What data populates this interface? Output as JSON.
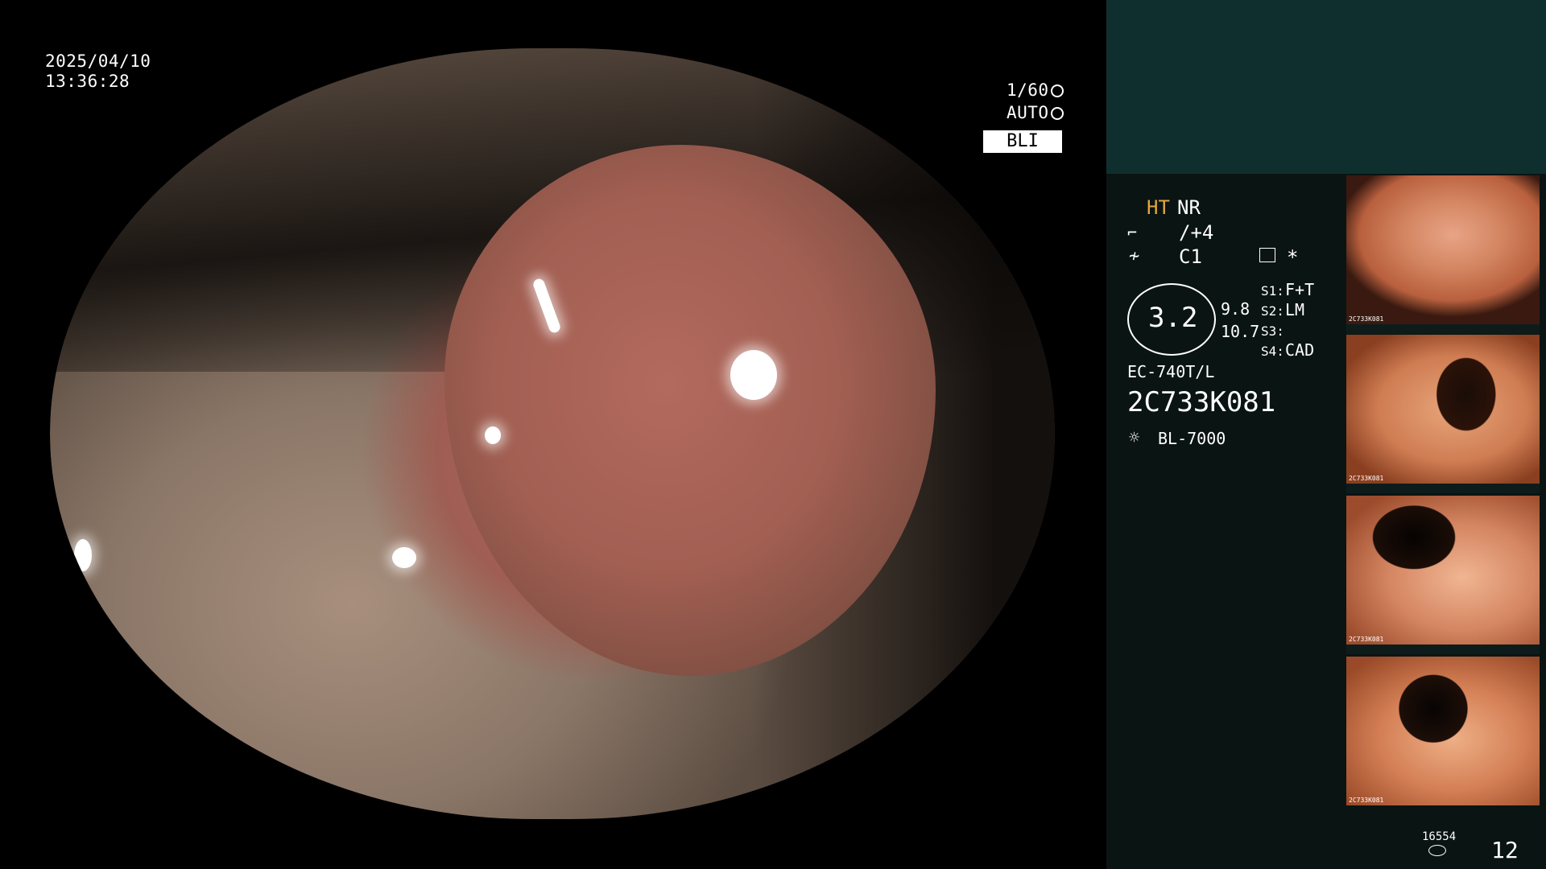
{
  "overlay": {
    "date": "2025/04/10",
    "time": "13:36:28",
    "shutter": "1/60",
    "mode": "AUTO",
    "light_mode": "BLI"
  },
  "panel": {
    "ht_label": "HT",
    "nr_label": "NR",
    "enhance_value": "/+4",
    "color_value": "C1",
    "star": "*",
    "zoom_value": "3.2",
    "zoom_side_1": "9.8",
    "zoom_side_2": "10.7",
    "s1": "S1:",
    "s1_value": "F+T",
    "s2": "S2:",
    "s2_value": "LM",
    "s3": "S3:",
    "s3_value": "",
    "s4": "S4:",
    "s4_value": "CAD",
    "scope_model": "EC-740T/L",
    "scope_serial": "2C733K081",
    "light_source": "BL-7000",
    "thumb_label": "2C733K081",
    "counter_small": "16554",
    "counter_big": "12"
  },
  "icons": [
    "shutter-icon",
    "iris-icon",
    "enhance-icon",
    "color-icon",
    "settings-icon",
    "light-source-icon",
    "storage-icon"
  ]
}
